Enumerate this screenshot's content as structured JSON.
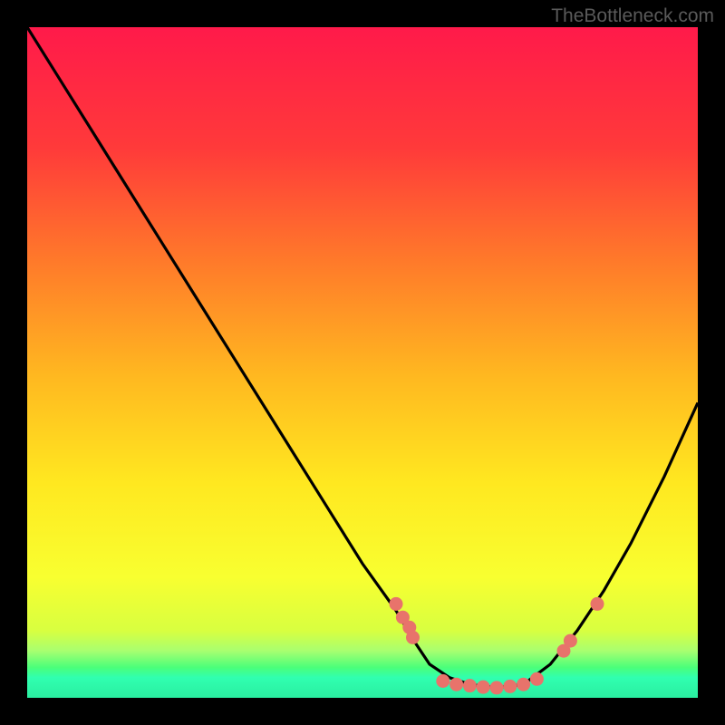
{
  "watermark": "TheBottleneck.com",
  "chart_data": {
    "type": "line",
    "title": "",
    "xlabel": "",
    "ylabel": "",
    "xlim": [
      0,
      100
    ],
    "ylim": [
      0,
      100
    ],
    "curve_points": [
      {
        "x": 0,
        "y": 100
      },
      {
        "x": 5,
        "y": 92
      },
      {
        "x": 10,
        "y": 84
      },
      {
        "x": 15,
        "y": 76
      },
      {
        "x": 20,
        "y": 68
      },
      {
        "x": 25,
        "y": 60
      },
      {
        "x": 30,
        "y": 52
      },
      {
        "x": 35,
        "y": 44
      },
      {
        "x": 40,
        "y": 36
      },
      {
        "x": 45,
        "y": 28
      },
      {
        "x": 50,
        "y": 20
      },
      {
        "x": 55,
        "y": 13
      },
      {
        "x": 58,
        "y": 8
      },
      {
        "x": 60,
        "y": 5
      },
      {
        "x": 63,
        "y": 3
      },
      {
        "x": 66,
        "y": 2
      },
      {
        "x": 70,
        "y": 1.5
      },
      {
        "x": 74,
        "y": 2
      },
      {
        "x": 78,
        "y": 5
      },
      {
        "x": 82,
        "y": 10
      },
      {
        "x": 86,
        "y": 16
      },
      {
        "x": 90,
        "y": 23
      },
      {
        "x": 95,
        "y": 33
      },
      {
        "x": 100,
        "y": 44
      }
    ],
    "marked_points": [
      {
        "x": 55,
        "y": 14
      },
      {
        "x": 56,
        "y": 12
      },
      {
        "x": 57,
        "y": 10.5
      },
      {
        "x": 57.5,
        "y": 9
      },
      {
        "x": 62,
        "y": 2.5
      },
      {
        "x": 64,
        "y": 2
      },
      {
        "x": 66,
        "y": 1.8
      },
      {
        "x": 68,
        "y": 1.6
      },
      {
        "x": 70,
        "y": 1.5
      },
      {
        "x": 72,
        "y": 1.7
      },
      {
        "x": 74,
        "y": 2
      },
      {
        "x": 76,
        "y": 2.8
      },
      {
        "x": 80,
        "y": 7
      },
      {
        "x": 81,
        "y": 8.5
      },
      {
        "x": 85,
        "y": 14
      }
    ],
    "gradient_colors": {
      "top": "#ff1a4a",
      "upper_mid": "#ff7a2a",
      "mid": "#ffd820",
      "lower_mid": "#e8ff30",
      "green_band": "#4aff7a",
      "bottom_green": "#2aeea0"
    }
  }
}
